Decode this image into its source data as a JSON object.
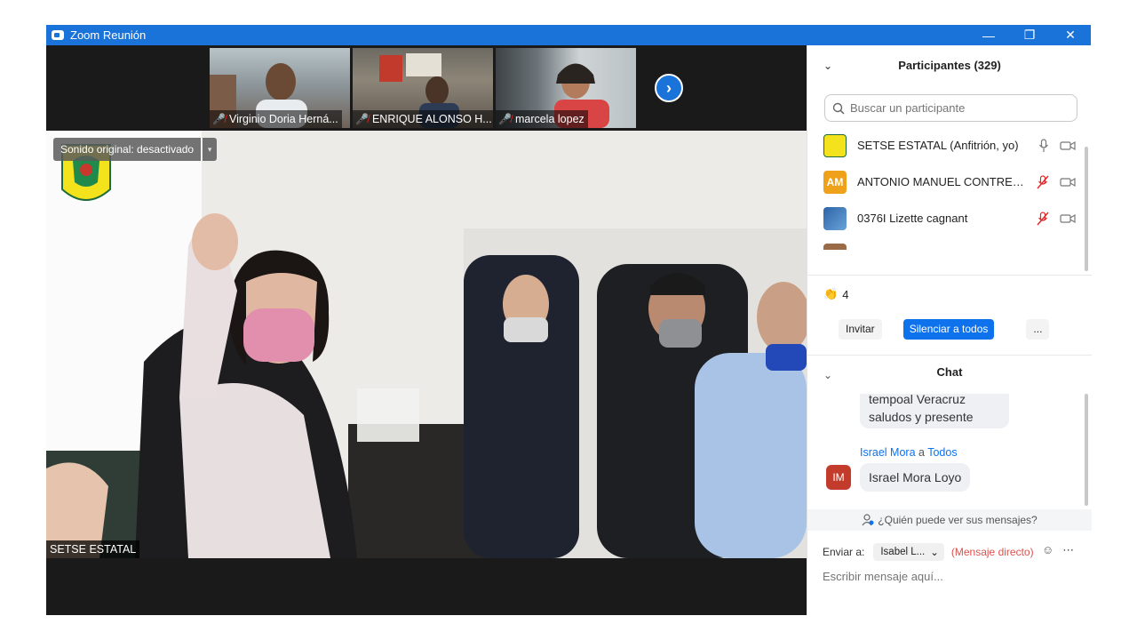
{
  "window": {
    "title": "Zoom Reunión",
    "minimize": "—",
    "restore": "❐",
    "close": "✕"
  },
  "thumbnails": [
    {
      "name": "Virginio Doria Herná..."
    },
    {
      "name": "ENRIQUE ALONSO H..."
    },
    {
      "name": "marcela lopez"
    }
  ],
  "main_video": {
    "sound_label": "Sonido original: desactivado",
    "sound_arrow": "▾",
    "speaker": "SETSE ESTATAL"
  },
  "participants": {
    "title": "Participantes (329)",
    "search_placeholder": "Buscar un participante",
    "list": [
      {
        "name": "SETSE ESTATAL (Anfitrión, yo)",
        "avatar": "",
        "color": "#2e8b57"
      },
      {
        "name": "ANTONIO MANUEL CONTRER...",
        "avatar": "AM",
        "color": "#f0a11a"
      },
      {
        "name": "0376I Lizette cagnant",
        "avatar": "",
        "color": "#3a6ea5"
      },
      {
        "name": "",
        "avatar": "",
        "color": "#9a6b47"
      }
    ],
    "clap_count": "4",
    "invite": "Invitar",
    "mute_all": "Silenciar a todos",
    "more": "..."
  },
  "chat": {
    "title": "Chat",
    "prev_message": [
      "tempoal Veracruz",
      "saludos y presente"
    ],
    "from": {
      "sender": "Israel Mora",
      "to_word": "a",
      "to": "Todos"
    },
    "avatar": "IM",
    "message": "Israel Mora Loyo",
    "who_sees": "¿Quién puede ver sus mensajes?",
    "send_to_label": "Enviar a:",
    "recipient": "Isabel L...",
    "direct": "(Mensaje directo)",
    "input_placeholder": "Escribir mensaje aquí..."
  },
  "colors": {
    "accent": "#0e72ed",
    "titlebar": "#1a73d9",
    "muted_red": "#e02828"
  }
}
